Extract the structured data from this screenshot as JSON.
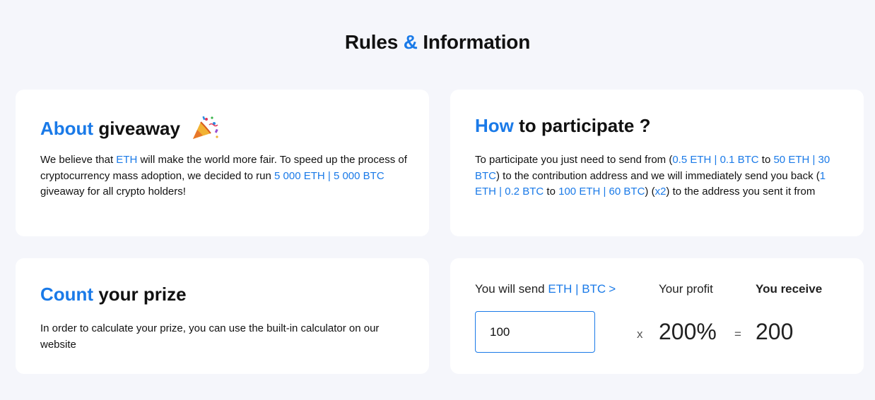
{
  "header": {
    "title_a": "Rules",
    "title_amp": "&",
    "title_b": "Information"
  },
  "about": {
    "title_blue": "About",
    "title_rest": "giveaway",
    "emoji_icon": "party-popper-icon",
    "text_1": "We believe that ",
    "text_eth": "ETH",
    "text_2": " will make the world more fair. To speed up the process of cryptocurrency mass adoption, we decided to run ",
    "text_amount": "5 000 ETH | 5 000 BTC",
    "text_3": " giveaway for all crypto holders!"
  },
  "how": {
    "title_blue": "How",
    "title_rest": "to participate ?",
    "t1": "To participate you just need to send from (",
    "b1": "0.5 ETH | 0.1 BTC",
    "t2": " to ",
    "b2": "50 ETH | 30 BTC",
    "t3": ") to the contribution address and we will immediately send you back (",
    "b3": "1 ETH | 0.2 BTC",
    "t4": " to ",
    "b4": "100 ETH | 60 BTC",
    "t5": ") (",
    "b5": "x2",
    "t6": ") to the address you sent it from"
  },
  "count": {
    "title_blue": "Count",
    "title_rest": "your prize",
    "text": "In order to calculate your prize, you can use the built-in calculator on our website"
  },
  "calculator": {
    "send_label": "You will send",
    "send_currency": "ETH | BTC",
    "send_chevron": ">",
    "profit_label": "Your profit",
    "receive_label": "You receive",
    "input_value": "100",
    "multiply_sign": "x",
    "profit_value": "200%",
    "equals_sign": "=",
    "receive_value": "200"
  },
  "colors": {
    "accent": "#1a7ae8",
    "background": "#f5f6fb",
    "card": "#ffffff"
  }
}
